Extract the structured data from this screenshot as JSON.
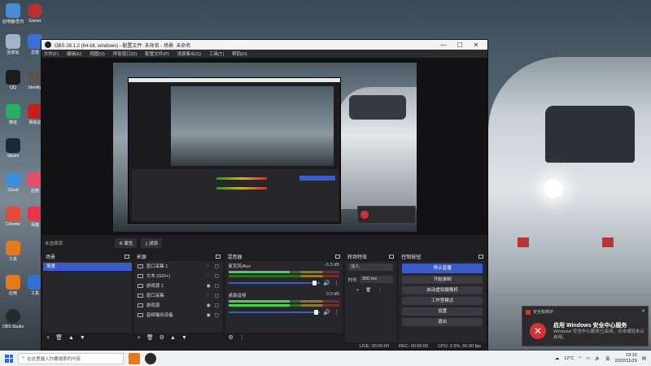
{
  "desktop_icons": [
    {
      "label": "此电脑/吾日三省吾身",
      "color": "#4b8ad6"
    },
    {
      "label": "回收站",
      "color": "#9fb4c7"
    },
    {
      "label": "QQ",
      "color": "#1d1d1d"
    },
    {
      "label": "微信",
      "color": "#2aae67"
    },
    {
      "label": "Steam",
      "color": "#1b2838"
    },
    {
      "label": "Cloud",
      "color": "#3c8fd8"
    },
    {
      "label": "Chrome",
      "color": "#e04b3a"
    },
    {
      "label": "工具",
      "color": "#e6781e"
    },
    {
      "label": "应用",
      "color": "#e6781e"
    },
    {
      "label": "OBS Studio",
      "color": "#2a2a2a"
    }
  ],
  "desktop_icons_right": [
    {
      "label": "Gamer",
      "color": "#b8302f"
    },
    {
      "label": "迅雷",
      "color": "#3a6fd6"
    },
    {
      "label": "Identity",
      "color": "#555"
    },
    {
      "label": "网易云",
      "color": "#c0201e"
    },
    {
      "label": "应用",
      "color": "#e94b6b"
    },
    {
      "label": "百度",
      "color": "#e9334b"
    },
    {
      "label": "工具",
      "color": "#3370d6"
    }
  ],
  "window": {
    "title": "OBS 28.1.2 (64-bit, windows) - 配置文件: 未命名 - 场景: 未命名",
    "minimize": "—",
    "maximize": "☐",
    "close": "✕"
  },
  "menu": [
    "文件(F)",
    "编辑(E)",
    "视图(V)",
    "停靠窗口(D)",
    "配置文件(P)",
    "场景集合(S)",
    "工具(T)",
    "帮助(H)"
  ],
  "toolbar": {
    "no_source": "未选择源",
    "properties": "⚙ 属性",
    "filters": "▯ 滤镜"
  },
  "scenes": {
    "title": "场景",
    "items": [
      "场景"
    ]
  },
  "sources": {
    "title": "来源",
    "items": [
      "窗口采集 1",
      "文本 (GDI+)",
      "游戏源 2",
      "窗口采集",
      "游戏源",
      "音频输出设备"
    ]
  },
  "mixer": {
    "title": "混音器",
    "channels": [
      {
        "name": "麦克风/Aux",
        "db": "-5.3 dB"
      },
      {
        "name": "桌面音频",
        "db": "0.0 dB"
      }
    ]
  },
  "transitions": {
    "title": "转场特效",
    "selected": "淡入",
    "duration_label": "时长",
    "duration_value": "300 ms"
  },
  "controls": {
    "title": "控制按钮",
    "buttons": [
      "停止直播",
      "开始录制",
      "启动虚拟摄像机",
      "工作室模式",
      "设置",
      "退出"
    ]
  },
  "status": {
    "live": "LIVE: 00:00:00",
    "rec": "REC: 00:00:00",
    "cpu": "CPU: 2.6%, 60.00 fps"
  },
  "toast": {
    "header": "安全和维护",
    "title": "启用 Windows 安全中心服务",
    "body": "Windows 安全中心服务已关闭。点击或轻击以启用。",
    "close": "✕"
  },
  "taskbar": {
    "search_placeholder": "在这里输入你要搜索的内容",
    "weather": "12°C",
    "ime": "英",
    "time": "19:16",
    "date": "2022/11/29"
  }
}
